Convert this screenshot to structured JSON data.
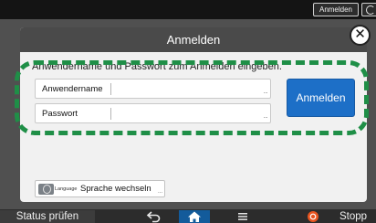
{
  "topbar": {
    "login_label": "Anmelden"
  },
  "dialog": {
    "title": "Anmelden",
    "instruction": "Anwendername und Passwort zum Anmelden eingeben.",
    "username_label": "Anwendername",
    "password_label": "Passwort",
    "login_button": "Anmelden",
    "field_more": "...",
    "language": {
      "small_label": "Language",
      "label": "Sprache wechseln",
      "more": "..."
    }
  },
  "bottombar": {
    "status_label": "Status prüfen",
    "stop_label": "Stopp"
  },
  "icons": [
    "close-icon",
    "globe-language-icon",
    "back-icon",
    "home-icon",
    "menu-icon",
    "stop-icon",
    "refresh-icon"
  ],
  "colors": {
    "accent": "#1d6fc7",
    "highlight": "#1f8f47",
    "home_active": "#135b9b",
    "stop": "#e8541f"
  }
}
